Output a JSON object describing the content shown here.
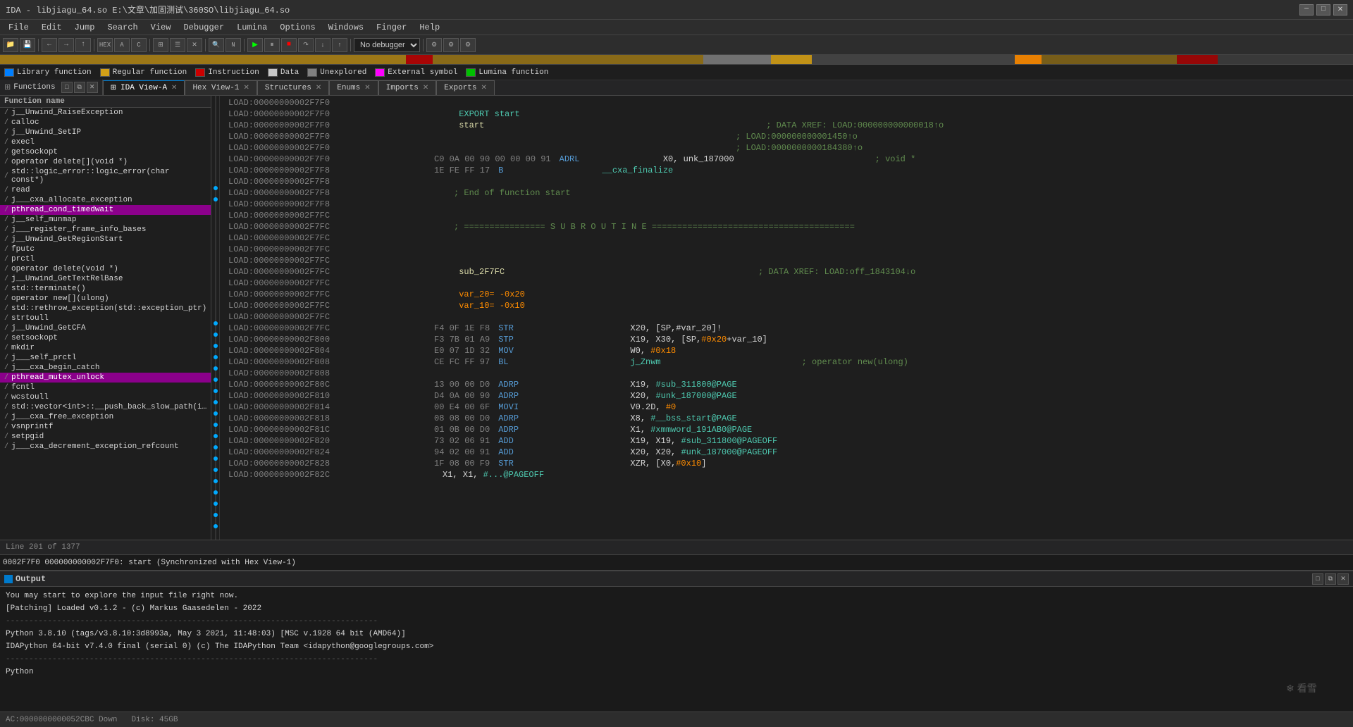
{
  "window": {
    "title": "IDA - libjiagu_64.so E:\\文章\\加固测试\\360SO\\libjiagu_64.so"
  },
  "menu": {
    "items": [
      "File",
      "Edit",
      "Jump",
      "Search",
      "View",
      "Debugger",
      "Lumina",
      "Options",
      "Windows",
      "Finger",
      "Help"
    ]
  },
  "legend": {
    "items": [
      {
        "color": "#007fff",
        "label": "Library function"
      },
      {
        "color": "#d4a017",
        "label": "Regular function"
      },
      {
        "color": "#cc0000",
        "label": "Instruction"
      },
      {
        "color": "#c8c8c8",
        "label": "Data"
      },
      {
        "color": "#808080",
        "label": "Unexplored"
      },
      {
        "color": "#ff00ff",
        "label": "External symbol"
      },
      {
        "color": "#00c000",
        "label": "Lumina function"
      }
    ]
  },
  "functions_panel": {
    "title": "Functions",
    "col_header": "Function name",
    "items": [
      {
        "name": "j__Unwind_RaiseException",
        "highlighted": false
      },
      {
        "name": "calloc",
        "highlighted": false
      },
      {
        "name": "j__Unwind_SetIP",
        "highlighted": false
      },
      {
        "name": "execl",
        "highlighted": false
      },
      {
        "name": "getsockopt",
        "highlighted": false
      },
      {
        "name": "operator delete[](void *)",
        "highlighted": false
      },
      {
        "name": "std::logic_error::logic_error(char const*)",
        "highlighted": false
      },
      {
        "name": "read",
        "highlighted": false
      },
      {
        "name": "j___cxa_allocate_exception",
        "highlighted": false
      },
      {
        "name": "pthread_cond_timedwait",
        "highlighted": true
      },
      {
        "name": "j__self_munmap",
        "highlighted": false
      },
      {
        "name": "j___register_frame_info_bases",
        "highlighted": false
      },
      {
        "name": "j__Unwind_GetRegionStart",
        "highlighted": false
      },
      {
        "name": "fputc",
        "highlighted": false
      },
      {
        "name": "prctl",
        "highlighted": false
      },
      {
        "name": "operator delete(void *)",
        "highlighted": false
      },
      {
        "name": "j__Unwind_GetTextRelBase",
        "highlighted": false
      },
      {
        "name": "std::terminate()",
        "highlighted": false
      },
      {
        "name": "operator new[](ulong)",
        "highlighted": false
      },
      {
        "name": "std::rethrow_exception(std::exception_ptr)",
        "highlighted": false
      },
      {
        "name": "strtoull",
        "highlighted": false
      },
      {
        "name": "j__Unwind_GetCFA",
        "highlighted": false
      },
      {
        "name": "setsockopt",
        "highlighted": false
      },
      {
        "name": "mkdir",
        "highlighted": false
      },
      {
        "name": "j___self_prctl",
        "highlighted": false
      },
      {
        "name": "j___cxa_begin_catch",
        "highlighted": false
      },
      {
        "name": "pthread_mutex_unlock",
        "highlighted": true
      },
      {
        "name": "fcntl",
        "highlighted": false
      },
      {
        "name": "wcstoull",
        "highlighted": false
      },
      {
        "name": "std::vector<int>::__push_back_slow_path(i…",
        "highlighted": false
      },
      {
        "name": "j___cxa_free_exception",
        "highlighted": false
      },
      {
        "name": "vsnprintf",
        "highlighted": false
      },
      {
        "name": "setpgid",
        "highlighted": false
      },
      {
        "name": "j___cxa_decrement_exception_refcount",
        "highlighted": false
      }
    ]
  },
  "tabs": {
    "main_tabs": [
      {
        "label": "IDA View-A",
        "active": true,
        "closeable": true
      },
      {
        "label": "Hex View-1",
        "active": false,
        "closeable": true
      },
      {
        "label": "Structures",
        "active": false,
        "closeable": true
      },
      {
        "label": "Enums",
        "active": false,
        "closeable": true
      },
      {
        "label": "Imports",
        "active": false,
        "closeable": true
      },
      {
        "label": "Exports",
        "active": false,
        "closeable": true
      }
    ]
  },
  "ida_view": {
    "lines": [
      {
        "addr": "LOAD:00000000002F7F0",
        "bytes": "",
        "mnemonic": "",
        "operand": "",
        "comment": ""
      },
      {
        "addr": "LOAD:00000000002F7F0",
        "bytes": "",
        "mnemonic": "",
        "operand": "EXPORT start",
        "comment": "",
        "type": "export"
      },
      {
        "addr": "LOAD:00000000002F7F0",
        "bytes": "",
        "mnemonic": "",
        "operand": "start",
        "comment": "; DATA XREF: LOAD:000000000000018↑o",
        "type": "label_comment"
      },
      {
        "addr": "LOAD:00000000002F7F0",
        "bytes": "",
        "mnemonic": "",
        "operand": "",
        "comment": "; LOAD:000000000001450↑o"
      },
      {
        "addr": "LOAD:00000000002F7F0",
        "bytes": "",
        "mnemonic": "",
        "operand": "",
        "comment": "; LOAD:0000000000184380↑o"
      },
      {
        "addr": "LOAD:00000000002F7F0",
        "bytes": "C0 0A 00 90 00 00 00 91",
        "mnemonic": "ADRL",
        "operand": "X0, unk_187000",
        "comment": "; void *",
        "has_dot": true
      },
      {
        "addr": "LOAD:00000000002F7F8",
        "bytes": "1E FE FF 17",
        "mnemonic": "B",
        "operand": "__cxa_finalize",
        "comment": "",
        "has_dot": true
      },
      {
        "addr": "LOAD:00000000002F7F8",
        "bytes": "",
        "mnemonic": "",
        "operand": "",
        "comment": ""
      },
      {
        "addr": "LOAD:00000000002F7F8",
        "bytes": "",
        "mnemonic": "",
        "operand": "; End of function start",
        "comment": "",
        "type": "comment_line"
      },
      {
        "addr": "LOAD:00000000002F7F8",
        "bytes": "",
        "mnemonic": "",
        "operand": "",
        "comment": ""
      },
      {
        "addr": "LOAD:00000000002F7FC",
        "bytes": "",
        "mnemonic": "",
        "operand": "",
        "comment": ""
      },
      {
        "addr": "LOAD:00000000002F7FC",
        "bytes": "",
        "mnemonic": "",
        "operand": "; ================ S U B R O U T I N E ========================================",
        "comment": "",
        "type": "separator"
      },
      {
        "addr": "LOAD:00000000002F7FC",
        "bytes": "",
        "mnemonic": "",
        "operand": "",
        "comment": ""
      },
      {
        "addr": "LOAD:00000000002F7FC",
        "bytes": "",
        "mnemonic": "",
        "operand": "",
        "comment": ""
      },
      {
        "addr": "LOAD:00000000002F7FC",
        "bytes": "",
        "mnemonic": "",
        "operand": "",
        "comment": ""
      },
      {
        "addr": "LOAD:00000000002F7FC",
        "bytes": "",
        "mnemonic": "",
        "operand": "sub_2F7FC",
        "comment": "; DATA XREF: LOAD:off_1843104↓o",
        "type": "sub_label"
      },
      {
        "addr": "LOAD:00000000002F7FC",
        "bytes": "",
        "mnemonic": "",
        "operand": "",
        "comment": ""
      },
      {
        "addr": "LOAD:00000000002F7FC",
        "bytes": "",
        "mnemonic": "",
        "operand": "var_20= -0x20",
        "comment": "",
        "type": "var"
      },
      {
        "addr": "LOAD:00000000002F7FC",
        "bytes": "",
        "mnemonic": "",
        "operand": "var_10= -0x10",
        "comment": "",
        "type": "var"
      },
      {
        "addr": "LOAD:00000000002F7FC",
        "bytes": "",
        "mnemonic": "",
        "operand": "",
        "comment": ""
      },
      {
        "addr": "LOAD:00000000002F7FC",
        "bytes": "F4 0F 1E F8",
        "mnemonic": "STR",
        "operand": "X20, [SP,#var_20]!",
        "comment": "",
        "has_dot": true
      },
      {
        "addr": "LOAD:00000000002F800",
        "bytes": "F3 7B 01 A9",
        "mnemonic": "STP",
        "operand": "X19, X30, [SP,#0x20+var_10]",
        "comment": "",
        "has_dot": true
      },
      {
        "addr": "LOAD:00000000002F804",
        "bytes": "E0 07 1D 32",
        "mnemonic": "MOV",
        "operand": "W0, #0x18",
        "comment": "",
        "has_dot": true
      },
      {
        "addr": "LOAD:00000000002F808",
        "bytes": "CE FC FF 97",
        "mnemonic": "BL",
        "operand": "j_Znwm",
        "comment": "; operator new(ulong)",
        "has_dot": true
      },
      {
        "addr": "LOAD:00000000002F808",
        "bytes": "",
        "mnemonic": "",
        "operand": "",
        "comment": ""
      },
      {
        "addr": "LOAD:00000000002F80C",
        "bytes": "13 00 00 D0",
        "mnemonic": "ADRP",
        "operand": "X19, #sub_311800@PAGE",
        "comment": "",
        "has_dot": true
      },
      {
        "addr": "LOAD:00000000002F810",
        "bytes": "D4 0A 00 90",
        "mnemonic": "ADRP",
        "operand": "X20, #unk_187000@PAGE",
        "comment": "",
        "has_dot": true
      },
      {
        "addr": "LOAD:00000000002F814",
        "bytes": "00 E4 00 6F",
        "mnemonic": "MOVI",
        "operand": "V0.2D, #0",
        "comment": "",
        "has_dot": true
      },
      {
        "addr": "LOAD:00000000002F818",
        "bytes": "08 08 00 D0",
        "mnemonic": "ADRP",
        "operand": "X8, #__bss_start@PAGE",
        "comment": "",
        "has_dot": true
      },
      {
        "addr": "LOAD:00000000002F81C",
        "bytes": "01 0B 00 D0",
        "mnemonic": "ADRP",
        "operand": "X1, #xmmword_191AB0@PAGE",
        "comment": "",
        "has_dot": true
      },
      {
        "addr": "LOAD:00000000002F820",
        "bytes": "73 02 06 91",
        "mnemonic": "ADD",
        "operand": "X19, X19, #sub_311800@PAGEOFF",
        "comment": "",
        "has_dot": true
      },
      {
        "addr": "LOAD:00000000002F824",
        "bytes": "94 02 00 91",
        "mnemonic": "ADD",
        "operand": "X20, X20, #unk_187000@PAGEOFF",
        "comment": "",
        "has_dot": true
      },
      {
        "addr": "LOAD:00000000002F828",
        "bytes": "1F 08 00 F9",
        "mnemonic": "STR",
        "operand": "XZR, [X0,#0x10]",
        "comment": "",
        "has_dot": true
      }
    ]
  },
  "status_bar": {
    "line_info": "Line 201 of 1377",
    "addr_info": "0002F7F0 000000000002F7F0: start (Synchronized with Hex View-1)"
  },
  "output_panel": {
    "title": "Output",
    "lines": [
      "You may start to explore the input file right now.",
      "[Patching] Loaded v0.1.2 - (c) Markus Gaasedelen - 2022",
      "--------------------------------------------------------------------------------",
      "Python 3.8.10 (tags/v3.8.10:3d8993a, May  3 2021, 11:48:03) [MSC v.1928 64 bit (AMD64)]",
      "IDAPython 64-bit v7.4.0 final (serial 0) (c) The IDAPython Team <idapython@googlegroups.com>",
      "--------------------------------------------------------------------------------",
      "Python"
    ]
  },
  "bottom_status": {
    "ac": "AC:0000000000052CBC Down",
    "disk": "Disk: 45GB"
  },
  "debugger_label": "No debugger"
}
